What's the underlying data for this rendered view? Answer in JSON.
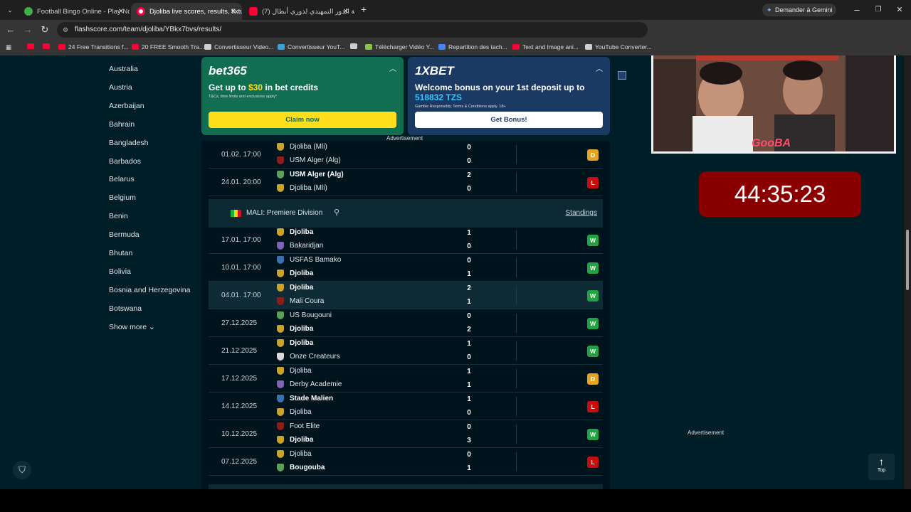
{
  "browser": {
    "tabs": [
      {
        "title": "Football Bingo Online - Play Now",
        "active": false
      },
      {
        "title": "Djoliba live scores, results, fixtures",
        "active": true
      },
      {
        "title": "(7) قرعة الدور التمهيدي لدوري أبطال",
        "active": false
      }
    ],
    "new_tab": "+",
    "gemini_button": "Demander à Gemini",
    "url": "flashscore.com/team/djoliba/YBkx7bvs/results/",
    "bookmarks": [
      {
        "label": "",
        "color": "#ff0033"
      },
      {
        "label": "",
        "color": "#ff0033"
      },
      {
        "label": "24 Free Transitions f...",
        "color": "#ff0033"
      },
      {
        "label": "20 FREE Smooth Tra...",
        "color": "#ff0033"
      },
      {
        "label": "Convertisseur Video...",
        "color": "#cfcfcf"
      },
      {
        "label": "Convertisseur YouT...",
        "color": "#3aa3d8"
      },
      {
        "label": "",
        "color": "#cfcfcf"
      },
      {
        "label": "Télécharger Vidéo Y...",
        "color": "#8bc34a"
      },
      {
        "label": "Repartition des tach...",
        "color": "#4285f4"
      },
      {
        "label": "Text and Image ani...",
        "color": "#ff0033"
      },
      {
        "label": "YouTube Converter...",
        "color": "#cfcfcf"
      }
    ]
  },
  "countries": [
    "Australia",
    "Austria",
    "Azerbaijan",
    "Bahrain",
    "Bangladesh",
    "Barbados",
    "Belarus",
    "Belgium",
    "Benin",
    "Bermuda",
    "Bhutan",
    "Bolivia",
    "Bosnia and Herzegovina",
    "Botswana"
  ],
  "show_more": "Show more",
  "ads": {
    "bet365": {
      "brand": "bet365",
      "headline_pre": "Get up to ",
      "headline_amount": "$30",
      "headline_post": " in bet credits",
      "fine": "T&Cs, time limits and exclusions apply*",
      "cta": "Claim now"
    },
    "xbet": {
      "brand": "1XBET",
      "headline": "Welcome bonus on your 1st deposit up to",
      "amount": "518832 TZS",
      "fine": "Gamble Responsibly. Terms & Conditions apply. 18+",
      "cta": "Get Bonus!"
    },
    "label": "Advertisement",
    "right_label": "Advertisement"
  },
  "results_top": [
    {
      "date": "01.02. 17:00",
      "home": "Djoliba (Mli)",
      "away": "USM Alger (Alg)",
      "home_score": "0",
      "away_score": "0",
      "winner": "",
      "result": "D"
    },
    {
      "date": "24.01. 20:00",
      "home": "USM Alger (Alg)",
      "away": "Djoliba (Mli)",
      "home_score": "2",
      "away_score": "0",
      "winner": "home",
      "result": "L"
    }
  ],
  "league": {
    "name": "MALI: Premiere Division",
    "standings": "Standings",
    "flag_colors": [
      "#14b53a",
      "#fcd116",
      "#ce1126"
    ]
  },
  "results": [
    {
      "date": "17.01. 17:00",
      "home": "Djoliba",
      "away": "Bakaridjan",
      "home_score": "1",
      "away_score": "0",
      "winner": "home",
      "result": "W"
    },
    {
      "date": "10.01. 17:00",
      "home": "USFAS Bamako",
      "away": "Djoliba",
      "home_score": "0",
      "away_score": "1",
      "winner": "away",
      "result": "W"
    },
    {
      "date": "04.01. 17:00",
      "home": "Djoliba",
      "away": "Mali Coura",
      "home_score": "2",
      "away_score": "1",
      "winner": "home",
      "result": "W"
    },
    {
      "date": "27.12.2025",
      "home": "US Bougouni",
      "away": "Djoliba",
      "home_score": "0",
      "away_score": "2",
      "winner": "away",
      "result": "W"
    },
    {
      "date": "21.12.2025",
      "home": "Djoliba",
      "away": "Onze Createurs",
      "home_score": "1",
      "away_score": "0",
      "winner": "home",
      "result": "W"
    },
    {
      "date": "17.12.2025",
      "home": "Djoliba",
      "away": "Derby Academie",
      "home_score": "1",
      "away_score": "1",
      "winner": "",
      "result": "D"
    },
    {
      "date": "14.12.2025",
      "home": "Stade Malien",
      "away": "Djoliba",
      "home_score": "1",
      "away_score": "0",
      "winner": "home",
      "result": "L"
    },
    {
      "date": "10.12.2025",
      "home": "Foot Elite",
      "away": "Djoliba",
      "home_score": "0",
      "away_score": "3",
      "winner": "away",
      "result": "W"
    },
    {
      "date": "07.12.2025",
      "home": "Djoliba",
      "away": "Bougouba",
      "home_score": "0",
      "away_score": "1",
      "winner": "away",
      "result": "L"
    }
  ],
  "overlay": {
    "webcam_label": "GooBA",
    "timer": "44:35:23"
  },
  "top_button": "Top",
  "colors": {
    "page_bg": "#001e28",
    "win": "#22a243",
    "draw": "#e5a51c",
    "loss": "#c70e0e",
    "timer_bg": "#8a0000"
  }
}
